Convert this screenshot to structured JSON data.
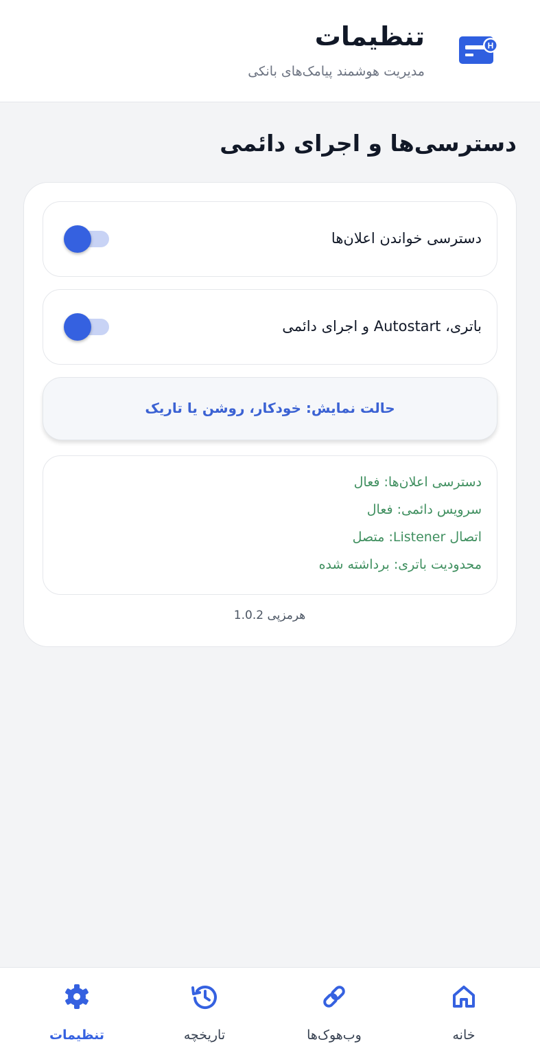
{
  "header": {
    "title": "تنظیمات",
    "subtitle": "مدیریت هوشمند پیامک‌های بانکی",
    "logo_icon": "bank-card-h-icon"
  },
  "section": {
    "title": "دسترسی‌ها و اجرای دائمی"
  },
  "toggles": [
    {
      "label": "دسترسی خواندن اعلان‌ها",
      "state": "on"
    },
    {
      "label": "باتری، Autostart و اجرای دائمی",
      "state": "on"
    }
  ],
  "theme_button": {
    "label": "حالت نمایش: خودکار، روشن یا تاریک"
  },
  "status": {
    "lines": [
      "دسترسی اعلان‌ها: فعال",
      "سرویس دائمی: فعال",
      "اتصال Listener: متصل",
      "محدودیت باتری: برداشته شده"
    ]
  },
  "version_text": "هرمزپی 1.0.2",
  "bottom_nav": {
    "items": [
      {
        "label": "خانه",
        "icon": "home-icon",
        "active": false
      },
      {
        "label": "وب‌هوک‌ها",
        "icon": "link-icon",
        "active": false
      },
      {
        "label": "تاریخچه",
        "icon": "history-icon",
        "active": false
      },
      {
        "label": "تنظیمات",
        "icon": "gear-icon",
        "active": true
      }
    ]
  },
  "colors": {
    "accent": "#3561e0",
    "status_green": "#3f8f5f",
    "background": "#f3f4f6"
  }
}
